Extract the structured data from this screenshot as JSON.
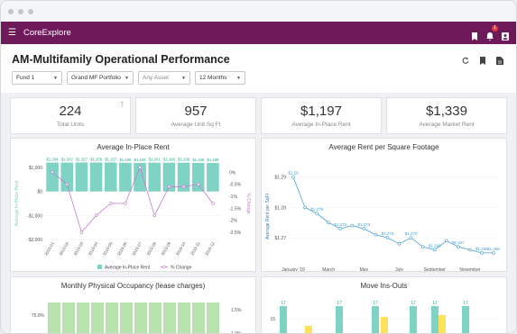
{
  "app": {
    "name": "CoreExplore",
    "notification_count": "1"
  },
  "page": {
    "title": "AM-Multifamily Operational Performance"
  },
  "filters": [
    {
      "label": "Fund 1"
    },
    {
      "label": "Grand MF Portfolio"
    },
    {
      "label": "Any Asset"
    },
    {
      "label": "12 Months"
    }
  ],
  "kpis": [
    {
      "value": "224",
      "label": "Total Units"
    },
    {
      "value": "957",
      "label": "Average Unit Sq Ft"
    },
    {
      "value": "$1,197",
      "label": "Average In-Place Rent"
    },
    {
      "value": "$1,339",
      "label": "Average Market Rent"
    }
  ],
  "chart_data": [
    {
      "type": "bar",
      "title": "Average In-Place Rent",
      "categories": [
        "2019-01",
        "2019-02",
        "2019-03",
        "2019-04",
        "2019-05",
        "2019-06",
        "2019-07",
        "2019-08",
        "2019-09",
        "2019-10",
        "2019-11",
        "2019-12"
      ],
      "series": [
        {
          "name": "Average In-Place Rent",
          "type": "bar",
          "values": [
            1204,
            1202,
            1207,
            1206,
            1207,
            1195,
            1193,
            1201,
            1198,
            1199,
            1189,
            1189
          ],
          "labels": [
            "$1,204",
            "$1,202",
            "$1,207",
            "$1,206",
            "$1,207",
            "$1,195",
            "$1,193",
            "$1,201",
            "$1,198",
            "$1,199",
            "$1,189",
            "$1,189"
          ]
        },
        {
          "name": "% Change",
          "type": "line",
          "values": [
            0.3,
            -0.2,
            -2.2,
            -1.5,
            -1.0,
            -1.0,
            0.5,
            -1.5,
            -0.3,
            -0.3,
            -0.2,
            -1.0
          ]
        }
      ],
      "ylabel": "Average In-Place Rent",
      "y2label": "% Change",
      "yticks": [
        "$1,000",
        "$0",
        "-$1,000",
        "-$2,000"
      ],
      "y2ticks": [
        "0%",
        "-0.5%",
        "-1%",
        "-1.5%",
        "-2%",
        "-2.5%"
      ],
      "legend": "bottom"
    },
    {
      "type": "line",
      "title": "Average Rent per Square Footage",
      "ylabel": "Average Rent per SqFt",
      "xticks": [
        "January '19",
        "March",
        "May",
        "July",
        "September",
        "November"
      ],
      "yticks": [
        "$1.29",
        "$1.28",
        "$1.27"
      ],
      "values": [
        1.29,
        1.28,
        1.278,
        1.275,
        1.273,
        1.274,
        1.273,
        1.271,
        1.27,
        1.268,
        1.27,
        1.267,
        1.266,
        1.269,
        1.267,
        1.266,
        1.265,
        1.265
      ],
      "labels": [
        "$1.29",
        "$1.28",
        "$1.278",
        "$1.275",
        "$1.273",
        "$1.274",
        "$1.273",
        "$1.271",
        "$1.270",
        "$1.268",
        "$1.270",
        "$1.267",
        "$1.266",
        "$1.269",
        "$1.267",
        "$1.266",
        "$1.265",
        "$1.265"
      ]
    },
    {
      "type": "bar",
      "title": "Monthly Physical Occupancy (lease charges)",
      "yticks": [
        "75.0%",
        "50.0%"
      ],
      "y2ticks": [
        "1.5%",
        "1.0%"
      ]
    },
    {
      "type": "bar",
      "title": "Move Ins-Outs",
      "yticks": [
        "15",
        "10"
      ],
      "series": [
        {
          "name": "Move Ins",
          "values": [
            17,
            17,
            17,
            17,
            17,
            17
          ]
        }
      ]
    }
  ],
  "colors": {
    "brand": "#6e1a5a",
    "teal": "#7ed3c4",
    "purple": "#c47ad0",
    "blue": "#4a9fd5",
    "green": "#b9e3ae",
    "yellow": "#ffe25a"
  }
}
